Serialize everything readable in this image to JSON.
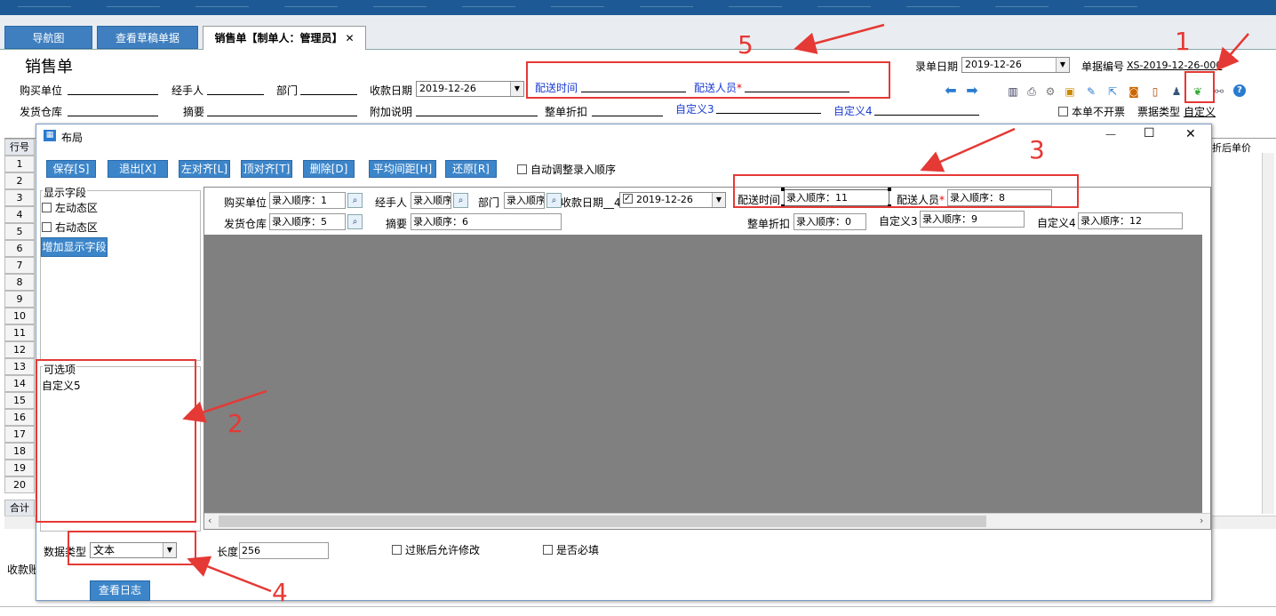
{
  "tabs": {
    "nav": "导航图",
    "drafts": "查看草稿单据",
    "active": "销售单【制单人：管理员】",
    "close_glyph": "✕"
  },
  "form": {
    "title": "销售单",
    "buyer": "购买单位",
    "handler": "经手人",
    "dept": "部门",
    "pay_date_label": "收款日期",
    "pay_date_value": "2019-12-26",
    "delivery_time": "配送时间",
    "delivery_person": "配送人员",
    "required_mark": "*",
    "entry_date_label": "录单日期",
    "entry_date_value": "2019-12-26",
    "doc_no_label": "单据编号",
    "doc_no_value": "XS-2019-12-26-000",
    "warehouse": "发货仓库",
    "summary": "摘要",
    "extra_note": "附加说明",
    "discount": "整单折扣",
    "custom3": "自定义3",
    "custom4": "自定义4",
    "no_invoice": "本单不开票",
    "invoice_type_label": "票据类型",
    "invoice_type_value": "自定义"
  },
  "grid": {
    "header_row": "行号",
    "header_right": "折后单价",
    "rows": [
      "1",
      "2",
      "3",
      "4",
      "5",
      "6",
      "7",
      "8",
      "9",
      "10",
      "11",
      "12",
      "13",
      "14",
      "15",
      "16",
      "17",
      "18",
      "19",
      "20"
    ],
    "total": "合计",
    "bottom_label": "收款账"
  },
  "dialog": {
    "title": "布局",
    "minimize": "—",
    "maximize": "☐",
    "close": "✕",
    "buttons": {
      "save": "保存[S]",
      "exit": "退出[X]",
      "left_align": "左对齐[L]",
      "top_align": "顶对齐[T]",
      "delete": "删除[D]",
      "even_spacing": "平均间距[H]",
      "restore": "还原[R]"
    },
    "auto_order": "自动调整录入顺序",
    "display_fields": "显示字段",
    "left_dynamic": "左动态区",
    "right_dynamic": "右动态区",
    "add_field": "增加显示字段",
    "optional": "可选项",
    "optional_items": [
      "自定义5"
    ],
    "canvas": {
      "buyer": "购买单位",
      "buyer_val": "录入顺序：1",
      "handler": "经手人",
      "handler_val": "录入顺序",
      "dept": "部门",
      "dept_val": "录入顺序",
      "pay_date": "收款日期__4",
      "pay_date_val": "2019-12-26",
      "delivery_time": "配送时间",
      "delivery_time_val": "录入顺序：11",
      "delivery_person": "配送人员",
      "delivery_person_val": "录入顺序：8",
      "warehouse": "发货仓库",
      "warehouse_val": "录入顺序：5",
      "summary": "摘要",
      "summary_val": "录入顺序：6",
      "discount": "整单折扣",
      "discount_val": "录入顺序：0",
      "custom3": "自定义3",
      "custom3_val": "录入顺序：9",
      "custom4": "自定义4",
      "custom4_val": "录入顺序：12"
    },
    "data_type_label": "数据类型",
    "data_type_value": "文本",
    "length_label": "长度",
    "length_value": "256",
    "allow_edit": "过账后允许修改",
    "required": "是否必填",
    "view_log": "查看日志"
  },
  "annotations": [
    "1",
    "2",
    "3",
    "4",
    "5"
  ],
  "colors": {
    "accent": "#3c85c9",
    "annotation": "#e53935",
    "field_blue": "#1a3bd0"
  }
}
